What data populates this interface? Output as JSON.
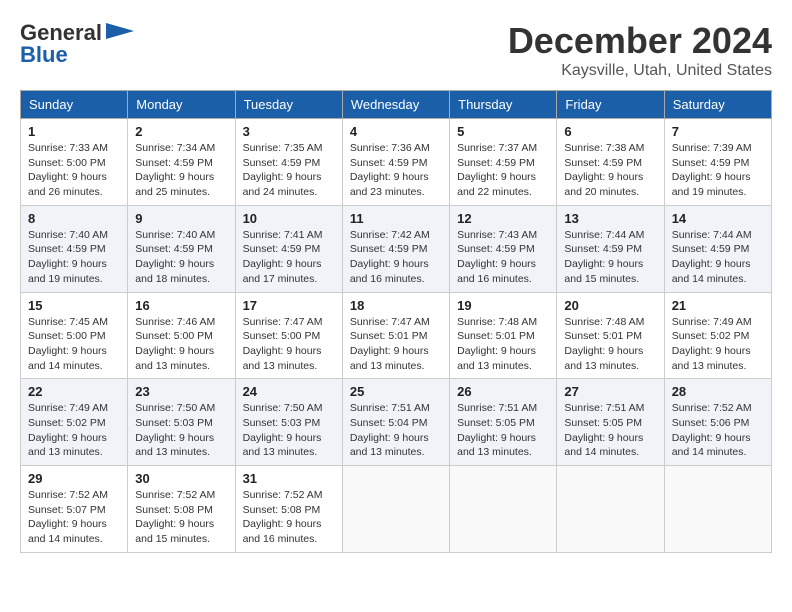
{
  "header": {
    "logo_line1": "General",
    "logo_line2": "Blue",
    "title": "December 2024",
    "subtitle": "Kaysville, Utah, United States"
  },
  "calendar": {
    "days_of_week": [
      "Sunday",
      "Monday",
      "Tuesday",
      "Wednesday",
      "Thursday",
      "Friday",
      "Saturday"
    ],
    "weeks": [
      [
        {
          "day": "1",
          "info": "Sunrise: 7:33 AM\nSunset: 5:00 PM\nDaylight: 9 hours\nand 26 minutes."
        },
        {
          "day": "2",
          "info": "Sunrise: 7:34 AM\nSunset: 4:59 PM\nDaylight: 9 hours\nand 25 minutes."
        },
        {
          "day": "3",
          "info": "Sunrise: 7:35 AM\nSunset: 4:59 PM\nDaylight: 9 hours\nand 24 minutes."
        },
        {
          "day": "4",
          "info": "Sunrise: 7:36 AM\nSunset: 4:59 PM\nDaylight: 9 hours\nand 23 minutes."
        },
        {
          "day": "5",
          "info": "Sunrise: 7:37 AM\nSunset: 4:59 PM\nDaylight: 9 hours\nand 22 minutes."
        },
        {
          "day": "6",
          "info": "Sunrise: 7:38 AM\nSunset: 4:59 PM\nDaylight: 9 hours\nand 20 minutes."
        },
        {
          "day": "7",
          "info": "Sunrise: 7:39 AM\nSunset: 4:59 PM\nDaylight: 9 hours\nand 19 minutes."
        }
      ],
      [
        {
          "day": "8",
          "info": "Sunrise: 7:40 AM\nSunset: 4:59 PM\nDaylight: 9 hours\nand 19 minutes."
        },
        {
          "day": "9",
          "info": "Sunrise: 7:40 AM\nSunset: 4:59 PM\nDaylight: 9 hours\nand 18 minutes."
        },
        {
          "day": "10",
          "info": "Sunrise: 7:41 AM\nSunset: 4:59 PM\nDaylight: 9 hours\nand 17 minutes."
        },
        {
          "day": "11",
          "info": "Sunrise: 7:42 AM\nSunset: 4:59 PM\nDaylight: 9 hours\nand 16 minutes."
        },
        {
          "day": "12",
          "info": "Sunrise: 7:43 AM\nSunset: 4:59 PM\nDaylight: 9 hours\nand 16 minutes."
        },
        {
          "day": "13",
          "info": "Sunrise: 7:44 AM\nSunset: 4:59 PM\nDaylight: 9 hours\nand 15 minutes."
        },
        {
          "day": "14",
          "info": "Sunrise: 7:44 AM\nSunset: 4:59 PM\nDaylight: 9 hours\nand 14 minutes."
        }
      ],
      [
        {
          "day": "15",
          "info": "Sunrise: 7:45 AM\nSunset: 5:00 PM\nDaylight: 9 hours\nand 14 minutes."
        },
        {
          "day": "16",
          "info": "Sunrise: 7:46 AM\nSunset: 5:00 PM\nDaylight: 9 hours\nand 13 minutes."
        },
        {
          "day": "17",
          "info": "Sunrise: 7:47 AM\nSunset: 5:00 PM\nDaylight: 9 hours\nand 13 minutes."
        },
        {
          "day": "18",
          "info": "Sunrise: 7:47 AM\nSunset: 5:01 PM\nDaylight: 9 hours\nand 13 minutes."
        },
        {
          "day": "19",
          "info": "Sunrise: 7:48 AM\nSunset: 5:01 PM\nDaylight: 9 hours\nand 13 minutes."
        },
        {
          "day": "20",
          "info": "Sunrise: 7:48 AM\nSunset: 5:01 PM\nDaylight: 9 hours\nand 13 minutes."
        },
        {
          "day": "21",
          "info": "Sunrise: 7:49 AM\nSunset: 5:02 PM\nDaylight: 9 hours\nand 13 minutes."
        }
      ],
      [
        {
          "day": "22",
          "info": "Sunrise: 7:49 AM\nSunset: 5:02 PM\nDaylight: 9 hours\nand 13 minutes."
        },
        {
          "day": "23",
          "info": "Sunrise: 7:50 AM\nSunset: 5:03 PM\nDaylight: 9 hours\nand 13 minutes."
        },
        {
          "day": "24",
          "info": "Sunrise: 7:50 AM\nSunset: 5:03 PM\nDaylight: 9 hours\nand 13 minutes."
        },
        {
          "day": "25",
          "info": "Sunrise: 7:51 AM\nSunset: 5:04 PM\nDaylight: 9 hours\nand 13 minutes."
        },
        {
          "day": "26",
          "info": "Sunrise: 7:51 AM\nSunset: 5:05 PM\nDaylight: 9 hours\nand 13 minutes."
        },
        {
          "day": "27",
          "info": "Sunrise: 7:51 AM\nSunset: 5:05 PM\nDaylight: 9 hours\nand 14 minutes."
        },
        {
          "day": "28",
          "info": "Sunrise: 7:52 AM\nSunset: 5:06 PM\nDaylight: 9 hours\nand 14 minutes."
        }
      ],
      [
        {
          "day": "29",
          "info": "Sunrise: 7:52 AM\nSunset: 5:07 PM\nDaylight: 9 hours\nand 14 minutes."
        },
        {
          "day": "30",
          "info": "Sunrise: 7:52 AM\nSunset: 5:08 PM\nDaylight: 9 hours\nand 15 minutes."
        },
        {
          "day": "31",
          "info": "Sunrise: 7:52 AM\nSunset: 5:08 PM\nDaylight: 9 hours\nand 16 minutes."
        },
        {
          "day": "",
          "info": ""
        },
        {
          "day": "",
          "info": ""
        },
        {
          "day": "",
          "info": ""
        },
        {
          "day": "",
          "info": ""
        }
      ]
    ]
  }
}
